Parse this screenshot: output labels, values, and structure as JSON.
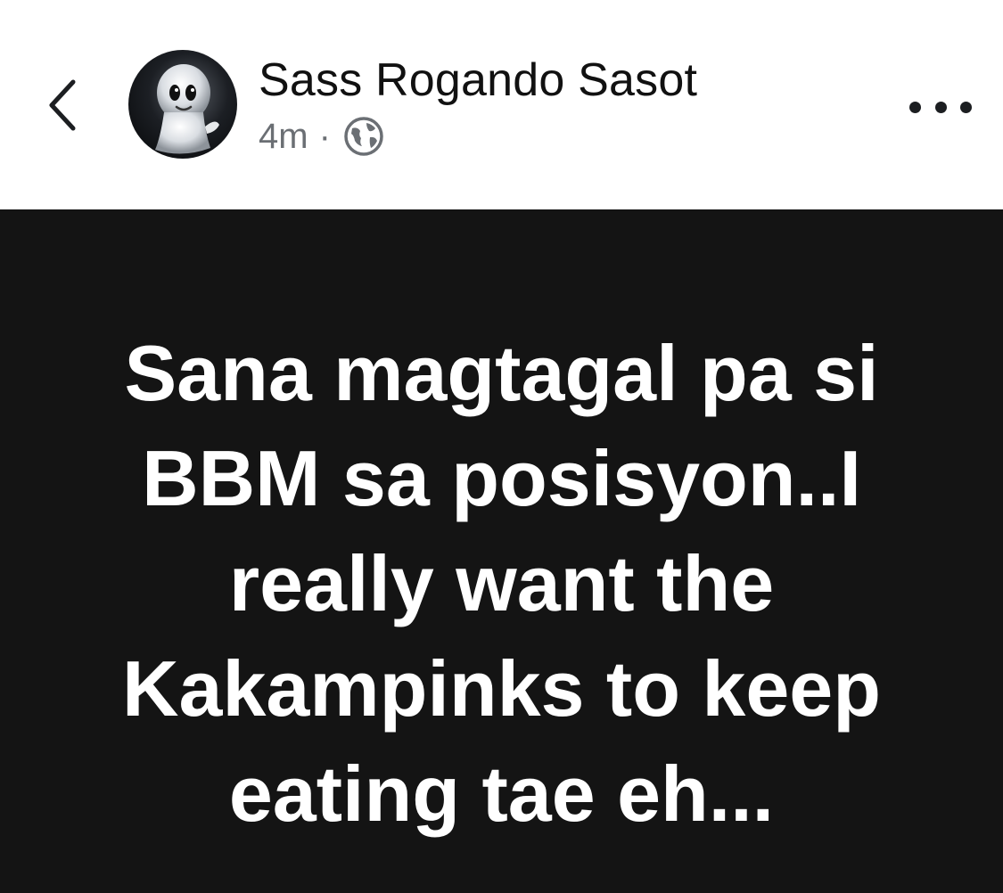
{
  "header": {
    "back_icon": "chevron-left-icon",
    "author_name": "Sass Rogando Sasot",
    "time": "4m",
    "separator": "·",
    "privacy_icon": "globe-icon",
    "more_icon": "more-horizontal-icon"
  },
  "post": {
    "background_color": "#141414",
    "text_color": "#ffffff",
    "lines": [
      "Sana magtagal pa si",
      "BBM sa posisyon..I",
      "really want the",
      "Kakampinks to keep",
      "eating tae eh..."
    ]
  }
}
